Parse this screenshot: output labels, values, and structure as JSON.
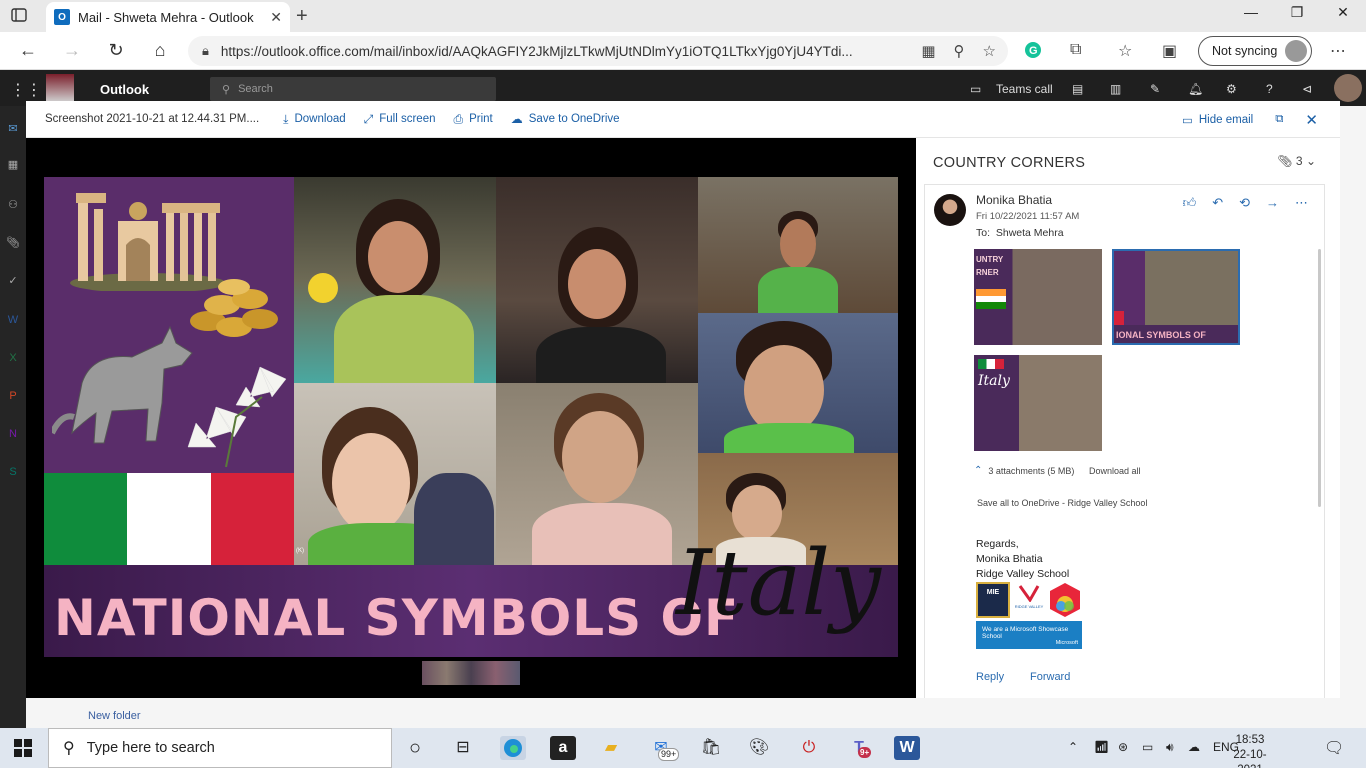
{
  "browser": {
    "tab_title": "Mail - Shweta Mehra - Outlook",
    "tab_favicon": "O",
    "url": "https://outlook.office.com/mail/inbox/id/AAQkAGFIY2JkMjlzLTkwMjUtNDlmYy1iOTQ1LTkxYjg0YjU4YTdi...",
    "sync_label": "Not syncing"
  },
  "outlook": {
    "app_name": "Outlook",
    "search_placeholder": "Search",
    "teams_call": "Teams call",
    "new_folder": "New folder"
  },
  "viewer": {
    "filename": "Screenshot 2021-10-21 at 12.44.31 PM....",
    "actions": [
      "Download",
      "Full screen",
      "Print",
      "Save to OneDrive"
    ],
    "hide_email": "Hide email"
  },
  "slide": {
    "banner_text": "NATIONAL SYMBOLS  OF",
    "banner_script": "Italy",
    "tile_label": "(K)",
    "flag_colors": [
      "#0f8c3c",
      "#ffffff",
      "#d6223a"
    ]
  },
  "email": {
    "subject": "COUNTRY CORNERS",
    "attachment_count": "3",
    "sender": "Monika Bhatia",
    "date": "Fri 10/22/2021 11:57 AM",
    "to_label": "To:",
    "to": "Shweta Mehra",
    "attachments_summary": "3 attachments (5 MB)",
    "download_all": "Download all",
    "save_all": "Save all to OneDrive - Ridge Valley School",
    "thumb1_text": "UNTRY\nRNER",
    "thumb2_text": "IONAL SYMBOLS  OF",
    "thumb3_text": "Italy",
    "signature": {
      "greeting": "Regards,",
      "name": "Monika Bhatia",
      "school": "Ridge Valley School"
    },
    "badges": {
      "mie": "MIE",
      "ridge": "RIDGE VALLEY",
      "showcase": "We are a Microsoft Showcase School",
      "microsoft": "Microsoft"
    },
    "reply": "Reply",
    "forward": "Forward"
  },
  "taskbar": {
    "search_placeholder": "Type here to search",
    "mail_badge": "99+",
    "teams_badge": "9+",
    "language": "ENG",
    "time": "18:53",
    "date": "22-10-2021"
  }
}
